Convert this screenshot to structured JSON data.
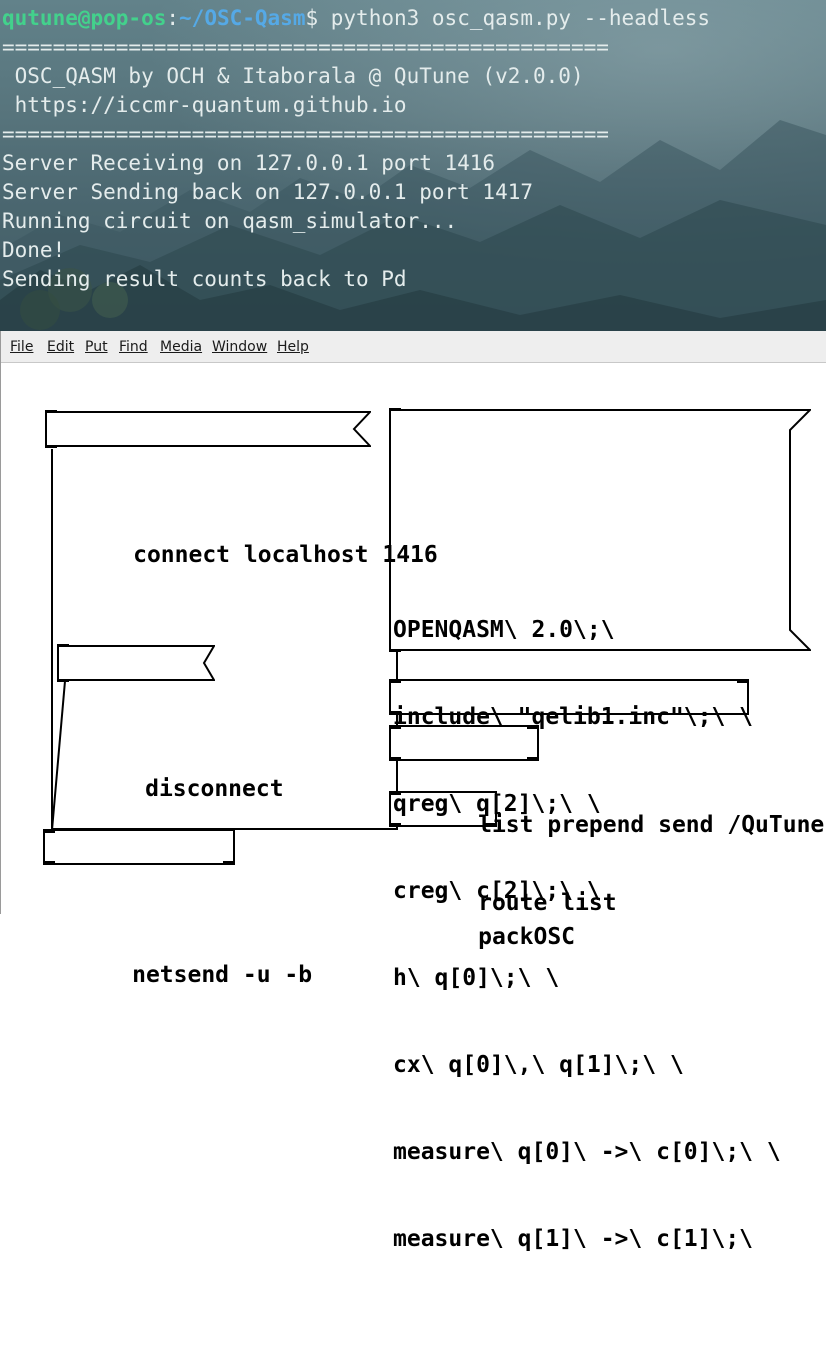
{
  "terminal": {
    "prompt_user": "qutune@pop-os",
    "prompt_sep": ":",
    "prompt_path": "~/OSC-Qasm",
    "prompt_symbol": "$",
    "command": " python3 osc_qasm.py --headless",
    "output": [
      "================================================",
      " OSC_QASM by OCH & Itaborala @ QuTune (v2.0.0)",
      " https://iccmr-quantum.github.io",
      "================================================",
      "Server Receiving on 127.0.0.1 port 1416",
      "Server Sending back on 127.0.0.1 port 1417",
      "Running circuit on qasm_simulator...",
      "Done!",
      "Sending result counts back to Pd"
    ],
    "colors": {
      "user": "#43d18c",
      "path": "#55a9e6",
      "text": "#e4ecec"
    }
  },
  "pd": {
    "menu": {
      "file": "File",
      "edit": "Edit",
      "put": "Put",
      "find": "Find",
      "media": "Media",
      "window": "Window",
      "help": "Help"
    },
    "messages": {
      "connect": "connect localhost 1416",
      "disconnect": "disconnect",
      "qasm_lines": [
        "OPENQASM\\ 2.0\\;\\",
        "include\\ \"qelib1.inc\"\\;\\ \\",
        "qreg\\ q[2]\\;\\ \\",
        "creg\\ c[2]\\;\\ \\",
        "h\\ q[0]\\;\\ \\",
        "cx\\ q[0]\\,\\ q[1]\\;\\ \\",
        "measure\\ q[0]\\ ->\\ c[0]\\;\\ \\",
        "measure\\ q[1]\\ ->\\ c[1]\\;\\"
      ]
    },
    "objects": {
      "list_prepend": "list prepend send /QuTune",
      "route": "route list",
      "packosc": "packOSC",
      "netsend": "netsend -u -b"
    }
  }
}
